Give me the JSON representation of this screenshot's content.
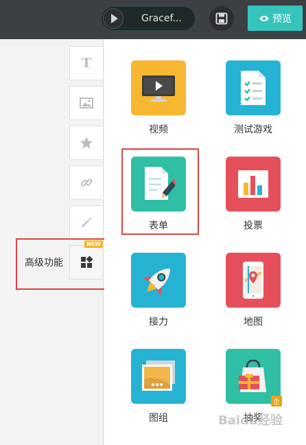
{
  "topbar": {
    "music_title": "Gracef...",
    "preview_label": "预览"
  },
  "tools": {
    "text_glyph": "T",
    "advanced_label": "高级功能",
    "new_badge": "NEW"
  },
  "items": [
    {
      "label": "视频",
      "color": "#f7b731",
      "icon": "monitor-play-icon"
    },
    {
      "label": "测试游戏",
      "color": "#26b3d3",
      "icon": "checklist-icon"
    },
    {
      "label": "表单",
      "color": "#2ebfa4",
      "icon": "form-edit-icon"
    },
    {
      "label": "投票",
      "color": "#e5505c",
      "icon": "bar-chart-icon"
    },
    {
      "label": "接力",
      "color": "#26b3d3",
      "icon": "rocket-icon"
    },
    {
      "label": "地图",
      "color": "#e5505c",
      "icon": "map-phone-icon"
    },
    {
      "label": "图组",
      "color": "#26b3d3",
      "icon": "image-gallery-icon"
    },
    {
      "label": "抽奖",
      "color": "#2ebfa4",
      "icon": "gift-bag-icon",
      "badge": "企"
    }
  ],
  "watermark": "Baidu经验"
}
